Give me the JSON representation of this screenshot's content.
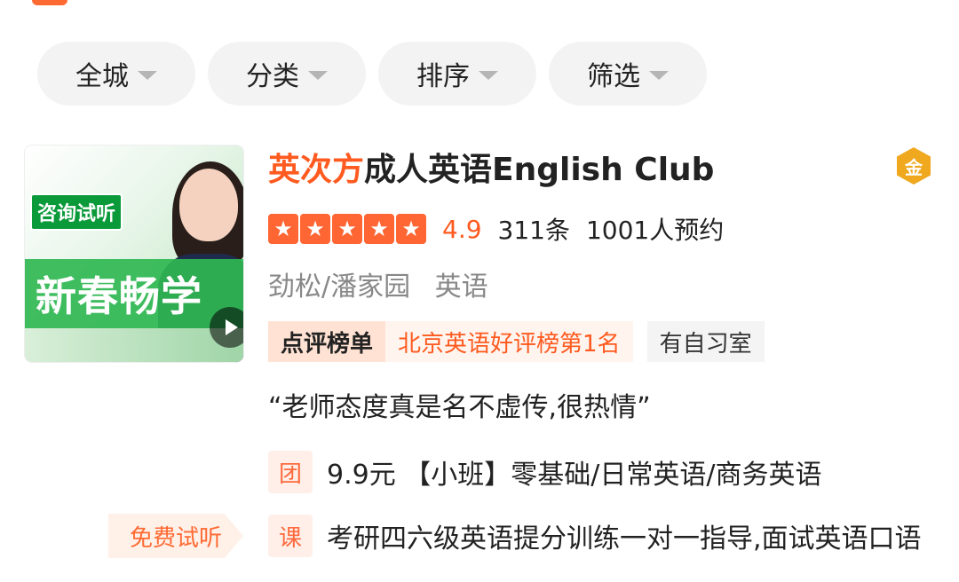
{
  "filters": [
    {
      "label": "全城"
    },
    {
      "label": "分类"
    },
    {
      "label": "排序"
    },
    {
      "label": "筛选"
    }
  ],
  "listing": {
    "thumbnail": {
      "badge": "咨询试听",
      "banner": "新春畅学"
    },
    "brand": "英次方",
    "title_rest": "成人英语English Club",
    "gold_badge": "金",
    "stars": 5,
    "score": "4.9",
    "reviews": "311条",
    "bookings": "1001人预约",
    "district": "劲松/潘家园",
    "category": "英语",
    "rank_label": "点评榜单",
    "rank_value": "北京英语好评榜第1名",
    "feature_tag": "有自习室",
    "quote": "“老师态度真是名不虚传,很热情”",
    "deals": [
      {
        "icon": "团",
        "text": "9.9元 【小班】零基础/日常英语/商务英语"
      },
      {
        "icon": "课",
        "text": "考研四六级英语提分训练一对一指导,面试英语口语"
      }
    ],
    "free_trial": "免费试听"
  },
  "colors": {
    "accent": "#ff5a1f",
    "chip_bg": "#f3f3f3",
    "rank_label_bg": "#ffe2d3",
    "green_banner": "#30b752"
  }
}
